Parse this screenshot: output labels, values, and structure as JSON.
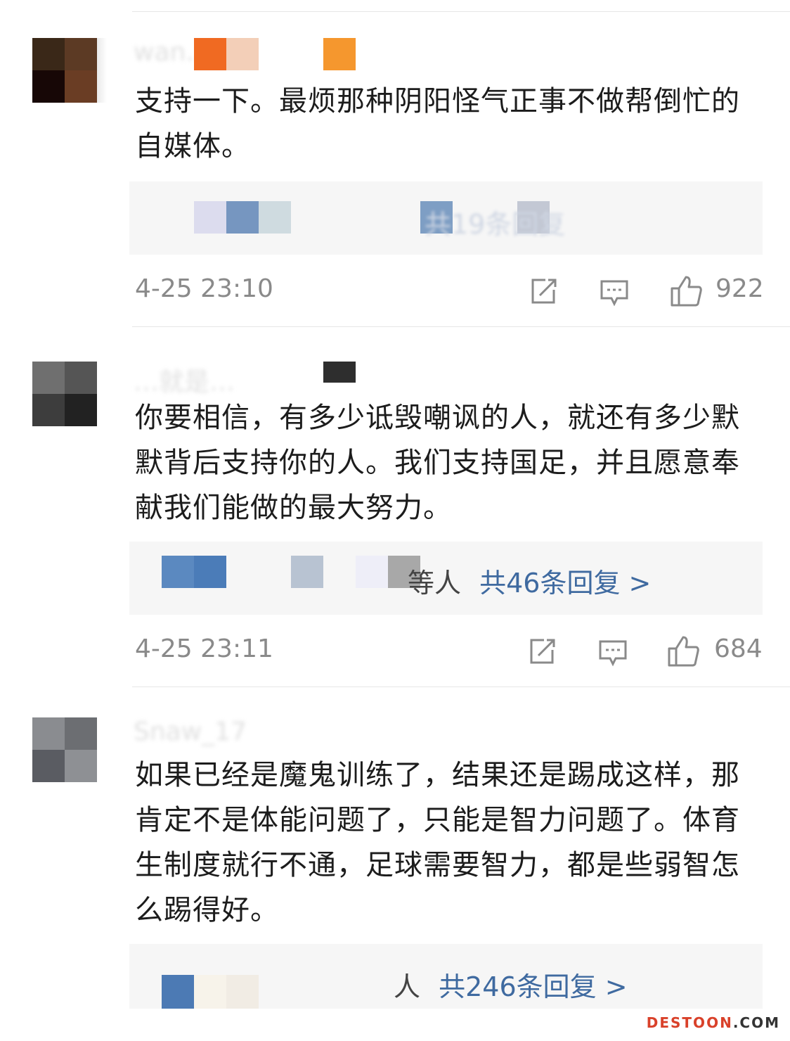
{
  "comments": [
    {
      "username": "wan...ong",
      "text": "支持一下。最烦那种阴阳怪气正事不做帮倒忙的自媒体。",
      "replies": {
        "summary": "共19条回复"
      },
      "time": "4-25 23:10",
      "likes": "922"
    },
    {
      "username": "…就是…",
      "text": "你要相信，有多少诋毁嘲讽的人，就还有多少默默背后支持你的人。我们支持国足，并且愿意奉献我们能做的最大努力。",
      "replies": {
        "prefix": "等人",
        "summary": "共46条回复 >"
      },
      "time": "4-25 23:11",
      "likes": "684"
    },
    {
      "username": "Snaw_17",
      "text": "如果已经是魔鬼训练了，结果还是踢成这样，那肯定不是体能问题了，只能是智力问题了。体育生制度就行不通，足球需要智力，都是些弱智怎么踢得好。",
      "replies": {
        "prefix": "人",
        "summary": "共246条回复 >"
      }
    }
  ],
  "icons": {
    "share": "share-icon",
    "comment": "comment-icon",
    "like": "thumbs-up-icon"
  },
  "watermark": {
    "brand": "DESTOON",
    "suffix": ".COM"
  },
  "colors": {
    "link": "#3f6aa0",
    "meta": "#8a8a8a",
    "reply_bg": "#f6f6f6",
    "watermark_red": "#d9412a",
    "watermark_dark": "#333333"
  }
}
